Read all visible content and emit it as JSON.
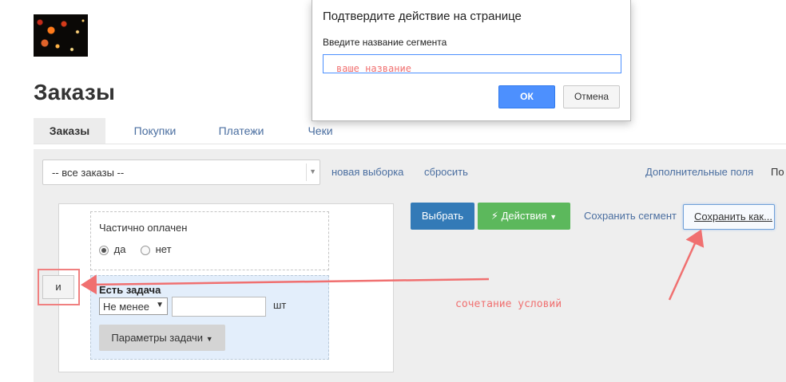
{
  "page": {
    "title": "Заказы"
  },
  "tabs": [
    {
      "label": "Заказы",
      "active": true
    },
    {
      "label": "Покупки",
      "active": false
    },
    {
      "label": "Платежи",
      "active": false
    },
    {
      "label": "Чеки",
      "active": false
    }
  ],
  "filter": {
    "segment_select": "-- все заказы --",
    "new_selection_link": "новая выборка",
    "reset_link": "сбросить",
    "extra_fields_link": "Дополнительные поля",
    "cut_label": "По"
  },
  "builder": {
    "condition1": {
      "label": "Частично оплачен",
      "option_yes": "да",
      "option_no": "нет",
      "selected": "да"
    },
    "condition2": {
      "label": "Есть задача",
      "operator": "Не менее",
      "value": "",
      "unit": "шт",
      "params_button": "Параметры задачи"
    },
    "combine_button": "и"
  },
  "actions": {
    "select_button": "Выбрать",
    "actions_button": "Действия",
    "save_segment_link": "Сохранить сегмент",
    "save_as_button": "Сохранить как..."
  },
  "annotation": {
    "text": "сочетание условий",
    "color": "#f07070"
  },
  "dialog": {
    "title": "Подтвердите действие на странице",
    "prompt": "Введите название сегмента",
    "input_value": "ваше название",
    "ok_button": "ОК",
    "cancel_button": "Отмена"
  },
  "colors": {
    "primary": "#337ab7",
    "success": "#5cb85c",
    "link": "#4a6ea0",
    "dialog_ok": "#4d90fe",
    "annotation_arrow": "#f07070"
  }
}
